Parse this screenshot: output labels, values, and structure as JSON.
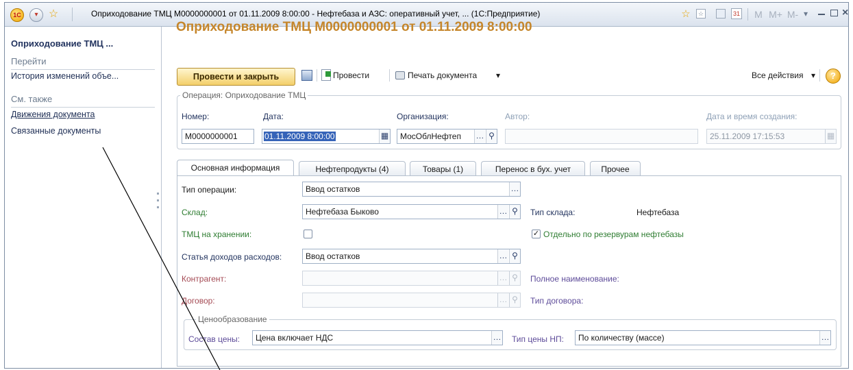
{
  "window": {
    "title": "Оприходование ТМЦ М0000000001 от 01.11.2009 8:00:00 - Нефтебаза и АЗС: оперативный учет, ... (1С:Предприятие)",
    "logo_text": "1С",
    "right_icons": [
      "star-icon",
      "favorites-icon",
      "calculator-icon",
      "calendar-icon"
    ],
    "memory_buttons": [
      "M",
      "M+",
      "M-"
    ],
    "controls": [
      "minimize-icon",
      "maximize-icon",
      "close-icon"
    ]
  },
  "left_panel": {
    "title": "Оприходование ТМЦ ...",
    "goto_header": "Перейти",
    "goto_items": [
      "История изменений объе..."
    ],
    "see_also_header": "См. также",
    "see_also_items": [
      "Движения документа",
      "Связанные документы"
    ]
  },
  "document": {
    "title": "Оприходование ТМЦ М0000000001 от 01.11.2009 8:00:00"
  },
  "toolbar": {
    "post_and_close": "Провести и закрыть",
    "post": "Провести",
    "print": "Печать документа",
    "all_actions": "Все действия",
    "help": "?"
  },
  "operation_group": {
    "label": "Операция: Оприходование ТМЦ",
    "number_label": "Номер:",
    "number_value": "М0000000001",
    "date_label": "Дата:",
    "date_value": "01.11.2009  8:00:00",
    "org_label": "Организация:",
    "org_value": "МосОблНефтеп",
    "author_label": "Автор:",
    "author_value": "",
    "created_label": "Дата и время создания:",
    "created_value": "25.11.2009 17:15:53"
  },
  "tabs": [
    {
      "label": "Основная информация",
      "active": true
    },
    {
      "label": "Нефтепродукты (4)",
      "active": false
    },
    {
      "label": "Товары (1)",
      "active": false
    },
    {
      "label": "Перенос в бух. учет",
      "active": false
    },
    {
      "label": "Прочее",
      "active": false
    }
  ],
  "main_info": {
    "op_type_label": "Тип операции:",
    "op_type_value": "Ввод остатков",
    "warehouse_label": "Склад:",
    "warehouse_value": "Нефтебаза Быково",
    "warehouse_type_label": "Тип склада:",
    "warehouse_type_value": "Нефтебаза",
    "storage_label": "ТМЦ на хранении:",
    "storage_checked": false,
    "separate_label": "Отдельно по резервурам нефтебазы",
    "separate_checked": true,
    "income_label": "Статья доходов расходов:",
    "income_value": "Ввод остатков",
    "counterparty_label": "Контрагент:",
    "counterparty_value": "",
    "full_name_label": "Полное наименование:",
    "contract_label": "Договор:",
    "contract_value": "",
    "contract_type_label": "Тип договора:"
  },
  "pricing": {
    "label": "Ценообразование",
    "composition_label": "Состав цены:",
    "composition_value": "Цена включает НДС",
    "price_type_label": "Тип цены НП:",
    "price_type_value": "По количеству (массе)"
  },
  "colors": {
    "title_orange": "#c5862b",
    "primary_button": "#f3cf6a",
    "link_blue": "#23345f",
    "green_label": "#2f7d32",
    "red_label": "#a44a54",
    "purple_label": "#5d4b99"
  }
}
